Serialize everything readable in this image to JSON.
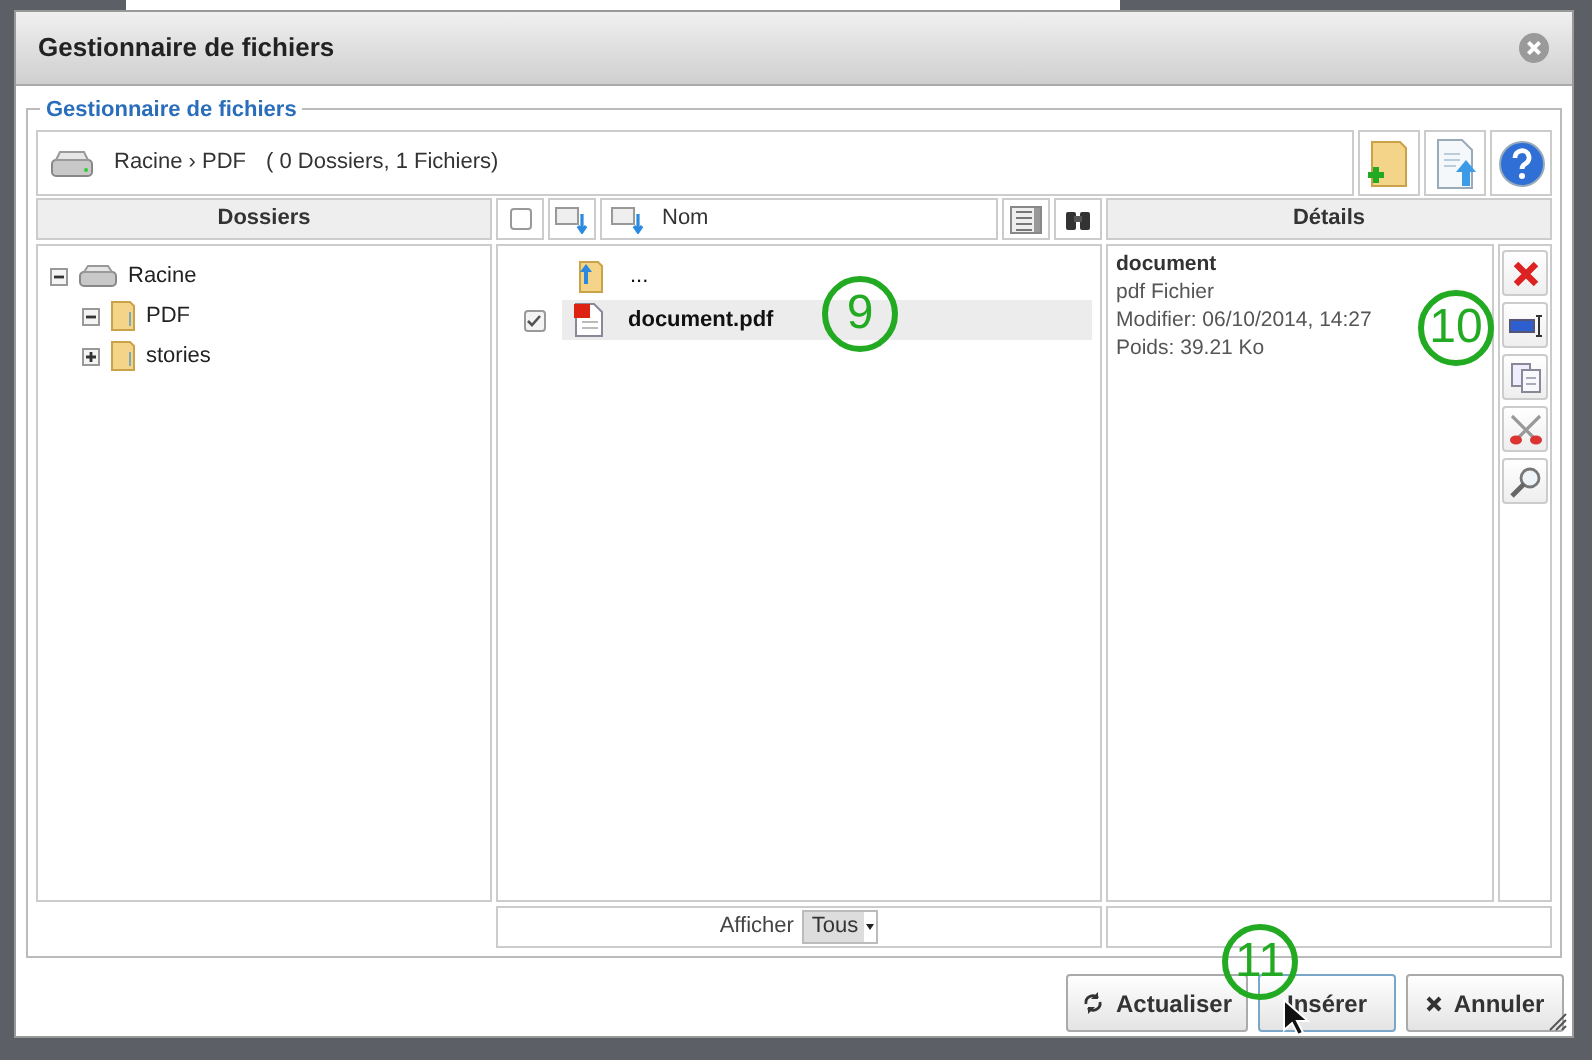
{
  "window": {
    "title": "Gestionnaire de fichiers"
  },
  "panel": {
    "legend": "Gestionnaire de fichiers"
  },
  "location": {
    "path": "Racine › PDF",
    "summary": "( 0 Dossiers, 1 Fichiers)"
  },
  "toolbar": [
    {
      "kind": "new-folder"
    },
    {
      "kind": "upload"
    },
    {
      "kind": "help"
    }
  ],
  "folders": {
    "header": "Dossiers",
    "tree": [
      {
        "label": "Racine",
        "kind": "drive",
        "expanded": true,
        "children": [
          {
            "label": "PDF",
            "kind": "folder",
            "expanded": true
          },
          {
            "label": "stories",
            "kind": "folder",
            "expanded": false
          }
        ]
      }
    ]
  },
  "files": {
    "header": "Nom",
    "all_checked": false,
    "items": [
      {
        "name": "...",
        "kind": "parent"
      },
      {
        "name": "document.pdf",
        "kind": "pdf",
        "checked": true,
        "selected": true
      }
    ]
  },
  "filter": {
    "label": "Afficher",
    "value": "Tous"
  },
  "details": {
    "header": "Détails",
    "name": "document",
    "type": "pdf Fichier",
    "modified": "Modifier: 06/10/2014, 14:27",
    "size": "Poids: 39.21 Ko",
    "actions": [
      {
        "kind": "delete"
      },
      {
        "kind": "rename"
      },
      {
        "kind": "copy"
      },
      {
        "kind": "cut"
      },
      {
        "kind": "preview"
      }
    ]
  },
  "buttons": [
    {
      "label": "Actualiser",
      "kind": "refresh"
    },
    {
      "label": "Insérer",
      "kind": "insert"
    },
    {
      "label": "Annuler",
      "kind": "cancel"
    }
  ],
  "callouts": [
    "9",
    "10",
    "11"
  ]
}
